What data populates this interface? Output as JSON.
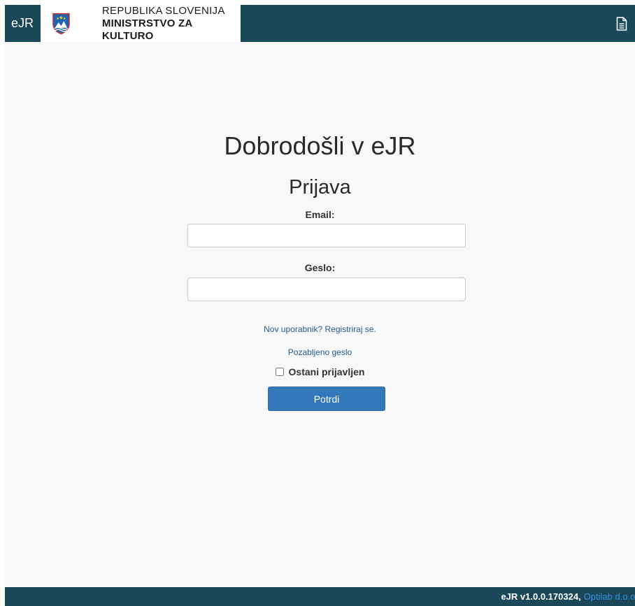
{
  "header": {
    "brand": "eJR",
    "logo_line1": "REPUBLIKA SLOVENIJA",
    "logo_line2": "MINISTRSTVO ZA KULTURO",
    "doc_icon": "document-icon",
    "coat_icon": "coat-of-arms-icon"
  },
  "main": {
    "welcome": "Dobrodošli v eJR",
    "login_title": "Prijava",
    "email_label": "Email:",
    "email_value": "",
    "password_label": "Geslo:",
    "password_value": "",
    "register_link": "Nov uporabnik? Registriraj se.",
    "forgot_link": "Pozabljeno geslo",
    "remember_label": "Ostani prijavljen",
    "remember_checked": false,
    "submit": "Potrdi"
  },
  "footer": {
    "version": "eJR v1.0.0.170324,",
    "company": "Optilab d.o.o."
  },
  "colors": {
    "header_bg": "#1b4858",
    "page_bg": "#f8f8f8",
    "primary_button": "#3278b8",
    "link": "#1f5a8f",
    "footer_link": "#3a8fd9"
  }
}
